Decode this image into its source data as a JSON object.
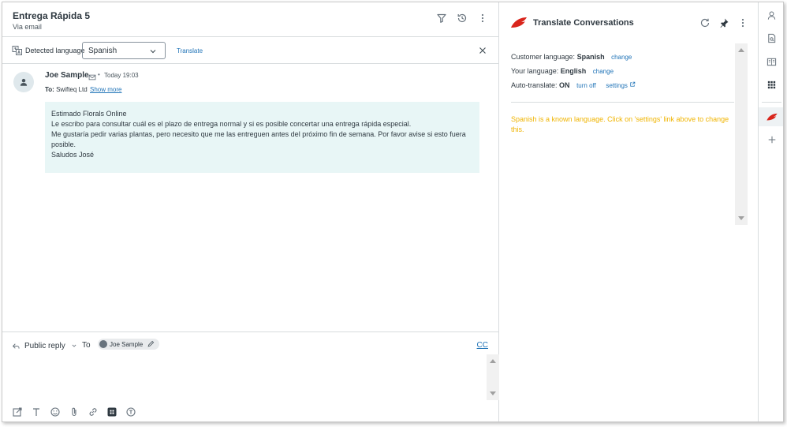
{
  "ticket": {
    "title": "Entrega Rápida 5",
    "channel": "Via email"
  },
  "language_bar": {
    "label": "Detected language",
    "selected": "Spanish",
    "translate_label": "Translate"
  },
  "message": {
    "author": "Joe Sample",
    "bullet": "•",
    "time": "Today 19:03",
    "to_label": "To:",
    "to_value": "Swifteq Ltd",
    "show_more": "Show more",
    "body": [
      "Estimado Florals Online",
      "Le escribo para consultar cuál es el plazo de entrega normal y si es posible concertar una entrega rápida especial.",
      "Me gustaría pedir varias plantas, pero necesito que me las entreguen antes del próximo fin de semana. Por favor avise si esto fuera posible.",
      "Saludos José"
    ]
  },
  "reply": {
    "type": "Public reply",
    "to_label": "To",
    "recipient": "Joe Sample",
    "cc_label": "CC"
  },
  "app": {
    "title": "Translate Conversations",
    "customer_language_label": "Customer language:",
    "customer_language": "Spanish",
    "your_language_label": "Your language:",
    "your_language": "English",
    "auto_translate_label": "Auto-translate:",
    "auto_translate": "ON",
    "change_label": "change",
    "turn_off_label": "turn off",
    "settings_label": "settings",
    "note": "Spanish is a known language. Click on 'settings' link above to change this."
  },
  "colors": {
    "link": "#1f73b7",
    "note": "#f0b400",
    "brand": "#d9251c",
    "message_bg": "#e8f6f6"
  }
}
